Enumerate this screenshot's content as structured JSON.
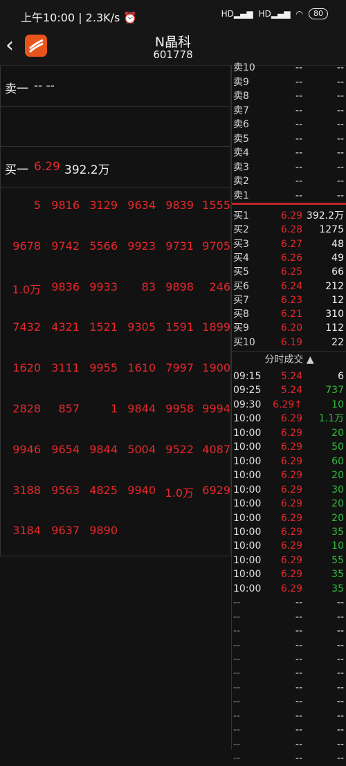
{
  "status": {
    "time": "上午10:00 | 2.3K/s ⏰",
    "hd1": "HD",
    "hd2": "HD",
    "battery": "80"
  },
  "header": {
    "back_icon": "chevron-left-icon",
    "name": "N晶科",
    "code": "601778"
  },
  "left": {
    "sell1": {
      "label": "卖一",
      "value": "-- --"
    },
    "buy1": {
      "label": "买一",
      "price": "6.29",
      "volume": "392.2万"
    },
    "queue": [
      [
        "5",
        "9816",
        "3129",
        "9634",
        "9839",
        "1555"
      ],
      [
        "9678",
        "9742",
        "5566",
        "9923",
        "9731",
        "9705"
      ],
      [
        "1.0万",
        "9836",
        "9933",
        "83",
        "9898",
        "246"
      ],
      [
        "7432",
        "4321",
        "1521",
        "9305",
        "1591",
        "1899"
      ],
      [
        "1620",
        "3111",
        "9955",
        "1610",
        "7997",
        "1900"
      ],
      [
        "2828",
        "857",
        "1",
        "9844",
        "9958",
        "9994"
      ],
      [
        "9946",
        "9654",
        "9844",
        "5004",
        "9522",
        "4087"
      ],
      [
        "3188",
        "9563",
        "4825",
        "9940",
        "1.0万",
        "6929"
      ],
      [
        "3184",
        "9637",
        "9890",
        "",
        "",
        ""
      ]
    ]
  },
  "orderbook": {
    "asks": [
      {
        "label": "卖10",
        "price": "--",
        "vol": "--"
      },
      {
        "label": "卖9",
        "price": "--",
        "vol": "--"
      },
      {
        "label": "卖8",
        "price": "--",
        "vol": "--"
      },
      {
        "label": "卖7",
        "price": "--",
        "vol": "--"
      },
      {
        "label": "卖6",
        "price": "--",
        "vol": "--"
      },
      {
        "label": "卖5",
        "price": "--",
        "vol": "--"
      },
      {
        "label": "卖4",
        "price": "--",
        "vol": "--"
      },
      {
        "label": "卖3",
        "price": "--",
        "vol": "--"
      },
      {
        "label": "卖2",
        "price": "--",
        "vol": "--"
      },
      {
        "label": "卖1",
        "price": "--",
        "vol": "--"
      }
    ],
    "bids": [
      {
        "label": "买1",
        "price": "6.29",
        "vol": "392.2万"
      },
      {
        "label": "买2",
        "price": "6.28",
        "vol": "1275"
      },
      {
        "label": "买3",
        "price": "6.27",
        "vol": "48"
      },
      {
        "label": "买4",
        "price": "6.26",
        "vol": "49"
      },
      {
        "label": "买5",
        "price": "6.25",
        "vol": "66"
      },
      {
        "label": "买6",
        "price": "6.24",
        "vol": "212"
      },
      {
        "label": "买7",
        "price": "6.23",
        "vol": "12"
      },
      {
        "label": "买8",
        "price": "6.21",
        "vol": "310"
      },
      {
        "label": "买9",
        "price": "6.20",
        "vol": "112"
      },
      {
        "label": "买10",
        "price": "6.19",
        "vol": "22"
      }
    ]
  },
  "ticks": {
    "header": "分时成交 ▲",
    "rows": [
      {
        "time": "09:15",
        "price": "5.24",
        "vol": "6",
        "vol_color": "white"
      },
      {
        "time": "09:25",
        "price": "5.24",
        "vol": "737",
        "vol_color": "green"
      },
      {
        "time": "09:30",
        "price": "6.29↑",
        "vol": "10",
        "vol_color": "green"
      },
      {
        "time": "10:00",
        "price": "6.29",
        "vol": "1.1万",
        "vol_color": "green"
      },
      {
        "time": "10:00",
        "price": "6.29",
        "vol": "20",
        "vol_color": "green"
      },
      {
        "time": "10:00",
        "price": "6.29",
        "vol": "50",
        "vol_color": "green"
      },
      {
        "time": "10:00",
        "price": "6.29",
        "vol": "60",
        "vol_color": "green"
      },
      {
        "time": "10:00",
        "price": "6.29",
        "vol": "20",
        "vol_color": "green"
      },
      {
        "time": "10:00",
        "price": "6.29",
        "vol": "30",
        "vol_color": "green"
      },
      {
        "time": "10:00",
        "price": "6.29",
        "vol": "20",
        "vol_color": "green"
      },
      {
        "time": "10:00",
        "price": "6.29",
        "vol": "20",
        "vol_color": "green"
      },
      {
        "time": "10:00",
        "price": "6.29",
        "vol": "35",
        "vol_color": "green"
      },
      {
        "time": "10:00",
        "price": "6.29",
        "vol": "10",
        "vol_color": "green"
      },
      {
        "time": "10:00",
        "price": "6.29",
        "vol": "55",
        "vol_color": "green"
      },
      {
        "time": "10:00",
        "price": "6.29",
        "vol": "35",
        "vol_color": "green"
      },
      {
        "time": "10:00",
        "price": "6.29",
        "vol": "35",
        "vol_color": "green"
      },
      {
        "time": "--",
        "price": "--",
        "vol": "--",
        "vol_color": "white"
      },
      {
        "time": "--",
        "price": "--",
        "vol": "--",
        "vol_color": "white"
      },
      {
        "time": "--",
        "price": "--",
        "vol": "--",
        "vol_color": "white"
      },
      {
        "time": "--",
        "price": "--",
        "vol": "--",
        "vol_color": "white"
      },
      {
        "time": "--",
        "price": "--",
        "vol": "--",
        "vol_color": "white"
      },
      {
        "time": "--",
        "price": "--",
        "vol": "--",
        "vol_color": "white"
      },
      {
        "time": "--",
        "price": "--",
        "vol": "--",
        "vol_color": "white"
      },
      {
        "time": "--",
        "price": "--",
        "vol": "--",
        "vol_color": "white"
      },
      {
        "time": "--",
        "price": "--",
        "vol": "--",
        "vol_color": "white"
      },
      {
        "time": "--",
        "price": "--",
        "vol": "--",
        "vol_color": "white"
      },
      {
        "time": "--",
        "price": "--",
        "vol": "--",
        "vol_color": "white"
      },
      {
        "time": "--",
        "price": "--",
        "vol": "--",
        "vol_color": "white"
      }
    ]
  },
  "colors": {
    "up": "#e8282b",
    "down": "#2fbf3a",
    "bg": "#121212"
  }
}
